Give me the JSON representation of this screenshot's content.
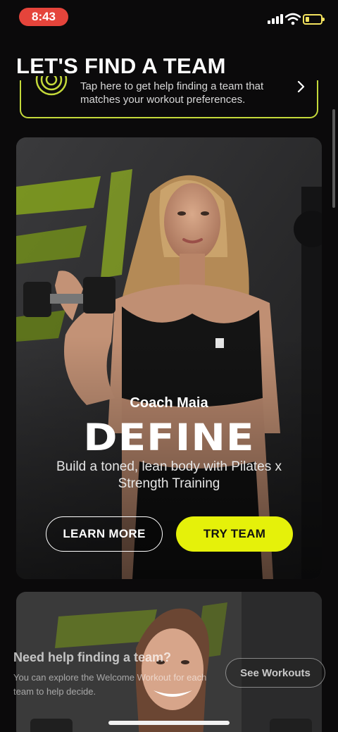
{
  "status_bar": {
    "time": "8:43",
    "signal_icon": "cellular-signal-icon",
    "wifi_icon": "wifi-icon",
    "battery_icon": "battery-low-icon",
    "battery_color": "#f3e25e",
    "time_pill_color": "#e5443b"
  },
  "page": {
    "title": "LET'S FIND A TEAM"
  },
  "help_banner": {
    "icon": "radar-icon",
    "text": "Tap here to get help finding a team that matches your workout preferences.",
    "chevron_icon": "chevron-right-icon",
    "border_color": "#c4d93a"
  },
  "teams": [
    {
      "coach": "Coach Maia",
      "name": "DEFINE",
      "description": "Build a toned, lean body with Pilates x Strength Training",
      "learn_more_label": "LEARN MORE",
      "try_label": "TRY TEAM",
      "accent_color": "#e5f10a"
    }
  ],
  "overlay": {
    "title": "Need help finding a team?",
    "text": "You can explore the Welcome Workout for each team to help decide.",
    "button_label": "See Workouts"
  }
}
